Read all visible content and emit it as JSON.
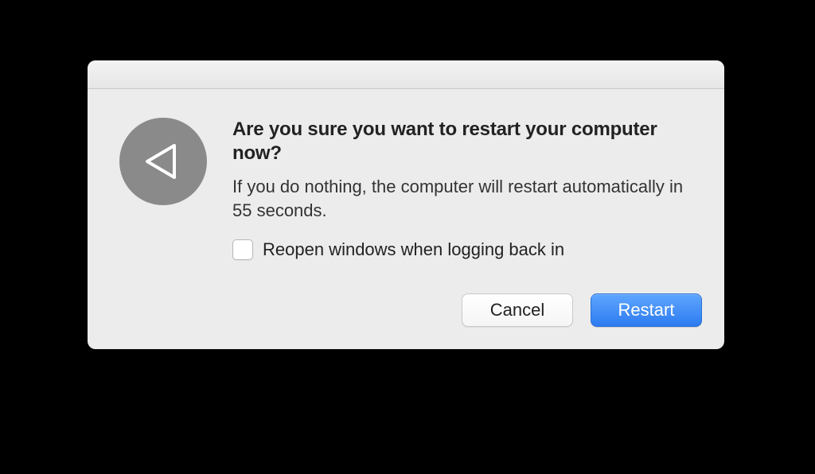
{
  "dialog": {
    "heading": "Are you sure you want to restart your computer now?",
    "description": "If you do nothing, the computer will restart automatically in 55 seconds.",
    "reopen_checkbox": {
      "label": "Reopen windows when logging back in",
      "checked": false
    },
    "buttons": {
      "cancel": "Cancel",
      "restart": "Restart"
    },
    "icon": "restart-triangle-icon"
  }
}
